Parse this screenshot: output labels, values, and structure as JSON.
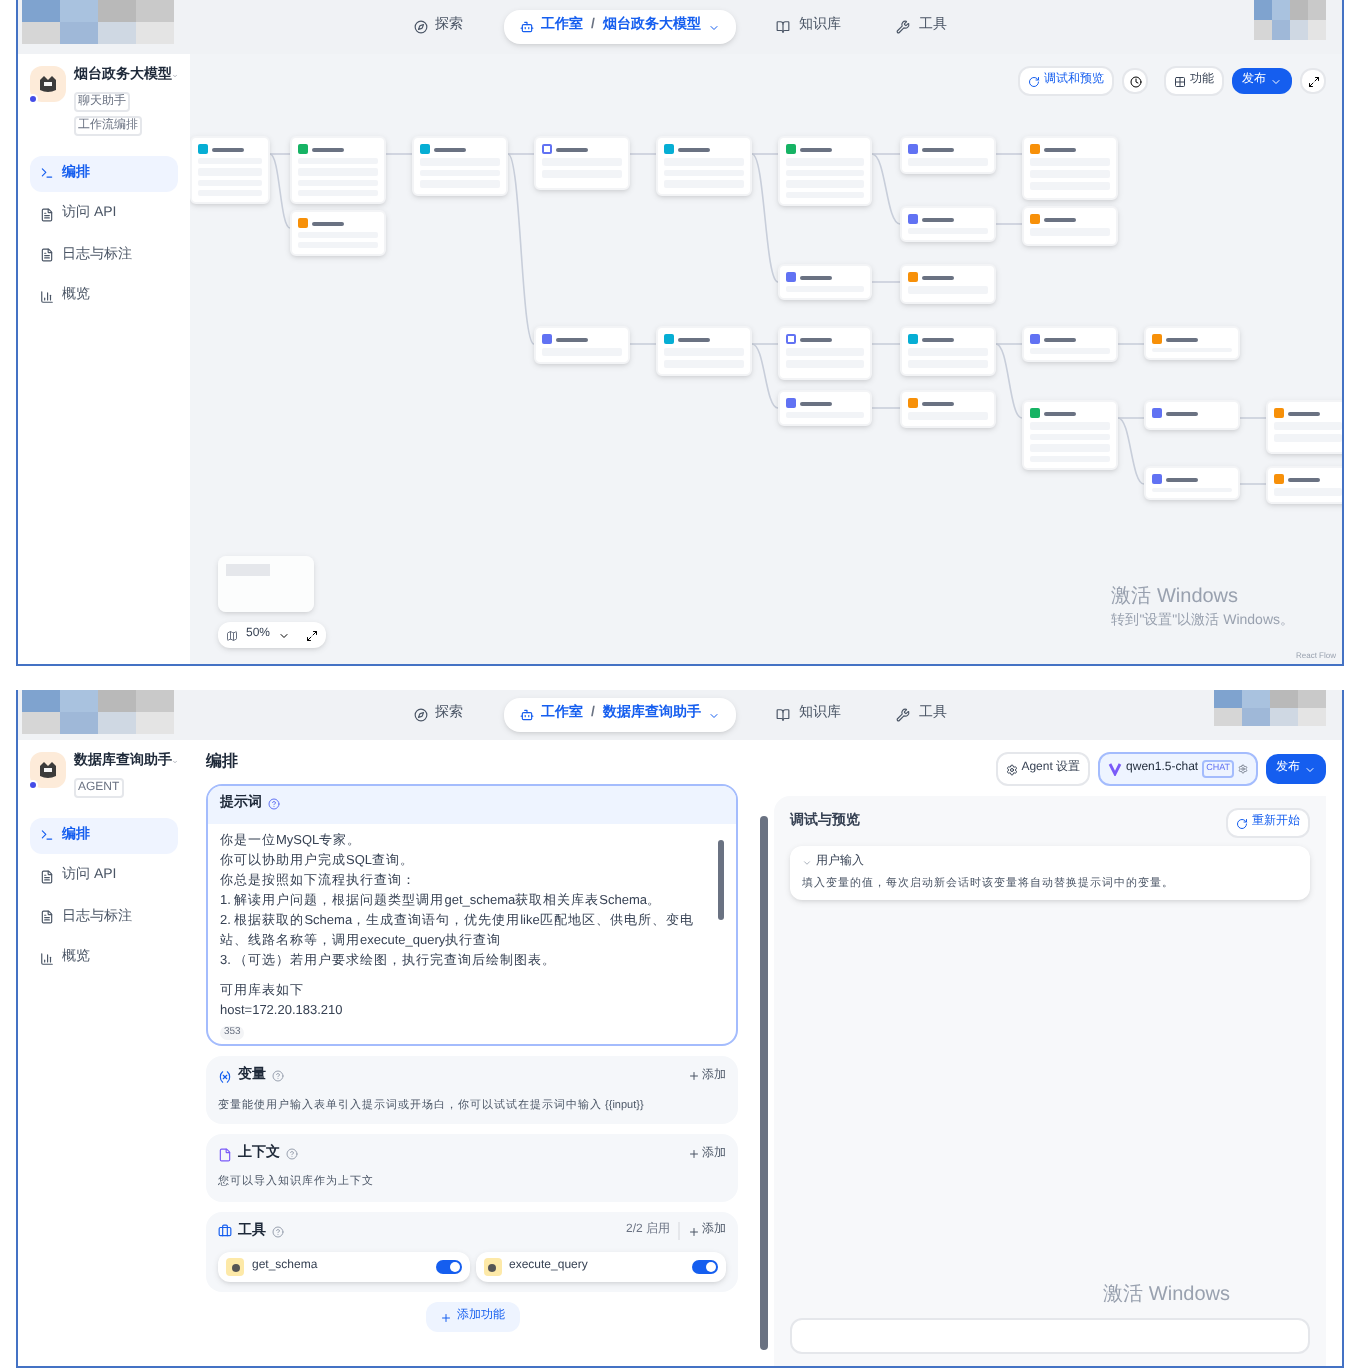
{
  "workflow_screen": {
    "nav": [
      {
        "label": "探索",
        "selected": false
      },
      {
        "label": "工作室",
        "selected": true,
        "separator": "/",
        "breadcrumb": "烟台政务大模型"
      },
      {
        "label": "知识库",
        "selected": false
      },
      {
        "label": "工具",
        "selected": false
      }
    ],
    "app": {
      "name": "烟台政务大模型",
      "tags": [
        "聊天助手",
        "工作流编排"
      ]
    },
    "menu": [
      {
        "label": "编排",
        "selected": true
      },
      {
        "label": "访问 API",
        "selected": false
      },
      {
        "label": "日志与标注",
        "selected": false
      },
      {
        "label": "概览",
        "selected": false
      }
    ],
    "toolbar": {
      "debug_button": "调试和预览",
      "features_button": "功能",
      "publish_button": "发布"
    },
    "nodes": [
      {
        "kind": "branch"
      },
      {
        "kind": "classifier"
      },
      {
        "kind": "answer"
      },
      {
        "kind": "assign"
      },
      {
        "kind": "search"
      },
      {
        "kind": "assign"
      },
      {
        "kind": "knowledge"
      },
      {
        "kind": "assign"
      },
      {
        "kind": "classifier"
      },
      {
        "kind": "llm"
      },
      {
        "kind": "answer"
      },
      {
        "kind": "knowledge"
      },
      {
        "kind": "answer"
      },
      {
        "kind": "knowledge"
      },
      {
        "kind": "answer"
      },
      {
        "kind": "search"
      },
      {
        "kind": "assign"
      },
      {
        "kind": "llm"
      },
      {
        "kind": "answer"
      },
      {
        "kind": "knowledge"
      },
      {
        "kind": "answer"
      },
      {
        "kind": "classifier"
      },
      {
        "kind": "llm"
      },
      {
        "kind": "answer"
      },
      {
        "kind": "knowledge"
      },
      {
        "kind": "answer"
      }
    ],
    "zoom": "50%",
    "attribution": "React Flow",
    "activation": {
      "title": "激活 Windows",
      "hint": "转到\"设置\"以激活 Windows。"
    }
  },
  "agent_screen": {
    "nav": [
      {
        "label": "探索",
        "selected": false
      },
      {
        "label": "工作室",
        "selected": true,
        "separator": "/",
        "breadcrumb": "数据库查询助手"
      },
      {
        "label": "知识库",
        "selected": false
      },
      {
        "label": "工具",
        "selected": false
      }
    ],
    "app": {
      "name": "数据库查询助手",
      "tags": [
        "AGENT"
      ]
    },
    "menu": [
      {
        "label": "编排",
        "selected": true
      },
      {
        "label": "访问 API",
        "selected": false
      },
      {
        "label": "日志与标注",
        "selected": false
      },
      {
        "label": "概览",
        "selected": false
      }
    ],
    "section_title": "编排",
    "prompt": {
      "title": "提示词",
      "paragraphs": [
        [
          "你是一位MySQL专家。",
          "你可以协助用户完成SQL查询。",
          "你总是按照如下流程执行查询：",
          "1. 解读用户问题，根据问题类型调用get_schema获取相关库表Schema。",
          "2. 根据获取的Schema，生成查询语句，优先使用like匹配地区、供电所、变电站、线路名称等，调用execute_query执行查询",
          "3. （可选）若用户要求绘图，执行完查询后绘制图表。"
        ],
        [
          "可用库表如下",
          "host=172.20.183.210"
        ]
      ],
      "count": "353"
    },
    "variables": {
      "title": "变量",
      "add": "添加",
      "hint": "变量能使用户输入表单引入提示词或开场白，你可以试试在提示词中输入 {{input}}"
    },
    "context": {
      "title": "上下文",
      "add": "添加",
      "hint": "您可以导入知识库作为上下文"
    },
    "tools": {
      "title": "工具",
      "status": "2/2 启用",
      "add": "添加",
      "items": [
        {
          "name": "get_schema",
          "on": true
        },
        {
          "name": "execute_query",
          "on": true
        }
      ]
    },
    "add_feature": "添加功能",
    "agent_settings": "Agent 设置",
    "model": {
      "name": "qwen1.5-chat",
      "badge": "CHAT"
    },
    "publish": "发布",
    "debug": {
      "title": "调试与预览",
      "restart": "重新开始",
      "input_title": "用户输入",
      "input_hint": "填入变量的值，每次启动新会话时该变量将自动替换提示词中的变量。"
    },
    "activation": {
      "title": "激活 Windows"
    }
  }
}
